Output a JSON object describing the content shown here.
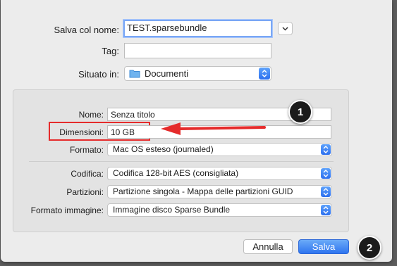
{
  "save_as": {
    "label": "Salva col nome:",
    "value": "TEST.sparsebundle"
  },
  "tag": {
    "label": "Tag:",
    "value": ""
  },
  "location": {
    "label": "Situato in:",
    "value": "Documenti",
    "icon": "folder-icon"
  },
  "options": {
    "name": {
      "label": "Nome:",
      "value": "Senza titolo"
    },
    "size": {
      "label": "Dimensioni:",
      "value": "10 GB"
    },
    "format": {
      "label": "Formato:",
      "value": "Mac OS esteso (journaled)"
    },
    "encryption": {
      "label": "Codifica:",
      "value": "Codifica 128-bit AES (consigliata)"
    },
    "partitions": {
      "label": "Partizioni:",
      "value": "Partizione singola - Mappa delle partizioni GUID"
    },
    "image_format": {
      "label": "Formato immagine:",
      "value": "Immagine disco Sparse Bundle"
    }
  },
  "buttons": {
    "cancel": "Annulla",
    "save": "Salva"
  },
  "annotations": {
    "step1": "1",
    "step2": "2",
    "highlight_color": "#e52b2b",
    "arrow_color": "#e52b2b"
  },
  "colors": {
    "accent": "#2f75ef"
  }
}
